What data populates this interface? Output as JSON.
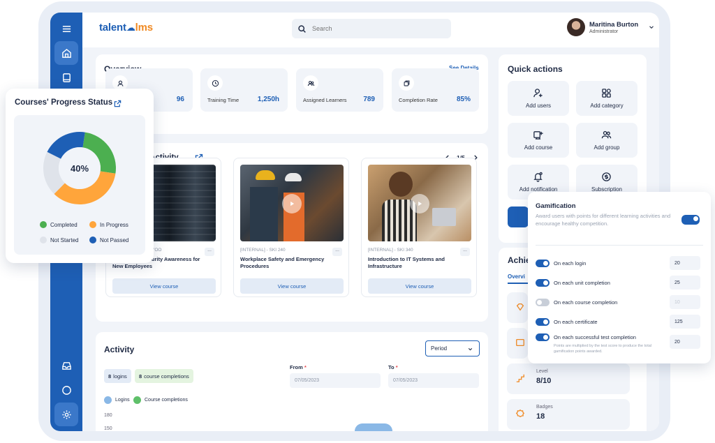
{
  "app": {
    "logo_left": "talent",
    "logo_right": "lms",
    "search_placeholder": "Search",
    "user": {
      "name": "Maritina Burton",
      "role": "Administrator"
    }
  },
  "overview": {
    "title": "Overview",
    "see_details": "See Details",
    "stats": [
      {
        "label": "",
        "value": "96",
        "icon": "users-icon"
      },
      {
        "label": "Training Time",
        "value": "1,250h",
        "icon": "clock-icon"
      },
      {
        "label": "Assigned Learners",
        "value": "789",
        "icon": "learners-icon"
      },
      {
        "label": "Completion Rate",
        "value": "85%",
        "icon": "completion-icon"
      }
    ]
  },
  "course_activity": {
    "title": "e Activity",
    "pager": "1/5",
    "courses": [
      {
        "code": "YOO",
        "name": "Basic Cybersecurity Awareness for New Employees",
        "button": "View course"
      },
      {
        "code": "[INTERNAL] - SKI 240",
        "name": "Workplace Safety and Emergency Procedures",
        "button": "View course"
      },
      {
        "code": "[INTERNAL] - SKI 340",
        "name": "Introduction to IT Systems and Infrastructure",
        "button": "View course"
      }
    ]
  },
  "activity": {
    "title": "Activity",
    "period": "Period",
    "logins_count": "8",
    "logins_label": "logins",
    "completions_count": "8",
    "completions_label": "course completions",
    "from_label": "From",
    "to_label": "To",
    "from_value": "07/05/2023",
    "to_value": "07/05/2023",
    "legend": [
      "Logins",
      "Course completions"
    ],
    "y_ticks": [
      "180",
      "150"
    ]
  },
  "quick_actions": {
    "title": "Quick actions",
    "items": [
      {
        "label": "Add users",
        "icon": "add-user-icon"
      },
      {
        "label": "Add category",
        "icon": "category-icon"
      },
      {
        "label": "Add course",
        "icon": "add-course-icon"
      },
      {
        "label": "Add group",
        "icon": "group-icon"
      },
      {
        "label": "Add notification",
        "icon": "notification-icon"
      },
      {
        "label": "Subscription",
        "icon": "subscription-icon"
      }
    ]
  },
  "achievements": {
    "title": "Achie",
    "tab": "Overvi",
    "items": [
      {
        "title": "Level",
        "value": "8/10",
        "icon": "level-icon"
      },
      {
        "title": "Badges",
        "value": "18",
        "icon": "badge-icon"
      }
    ]
  },
  "progress_status": {
    "title": "Courses' Progress Status",
    "center_label": "40%",
    "chart_data": {
      "type": "pie",
      "categories": [
        "Completed",
        "In Progress",
        "Not Started",
        "Not Passed"
      ],
      "values": [
        25,
        35,
        20,
        20
      ]
    },
    "colors": {
      "completed": "#4caf50",
      "in_progress": "#ffa53b",
      "not_started": "#dfe3ea",
      "not_passed": "#1e5fb5"
    }
  },
  "gamification": {
    "title": "Gamification",
    "description": "Award users with points for different learning activities and encourage healthy competition.",
    "enabled": true,
    "rows": [
      {
        "label": "On each login",
        "value": "20",
        "on": true
      },
      {
        "label": "On each unit completion",
        "value": "25",
        "on": true
      },
      {
        "label": "On each course completion",
        "value": "10",
        "on": false
      },
      {
        "label": "On each certificate",
        "value": "125",
        "on": true
      },
      {
        "label": "On each successful test completion",
        "value": "20",
        "on": true
      }
    ],
    "note": "Points are multiplied by the test score to produce the total gamification points awarded."
  }
}
